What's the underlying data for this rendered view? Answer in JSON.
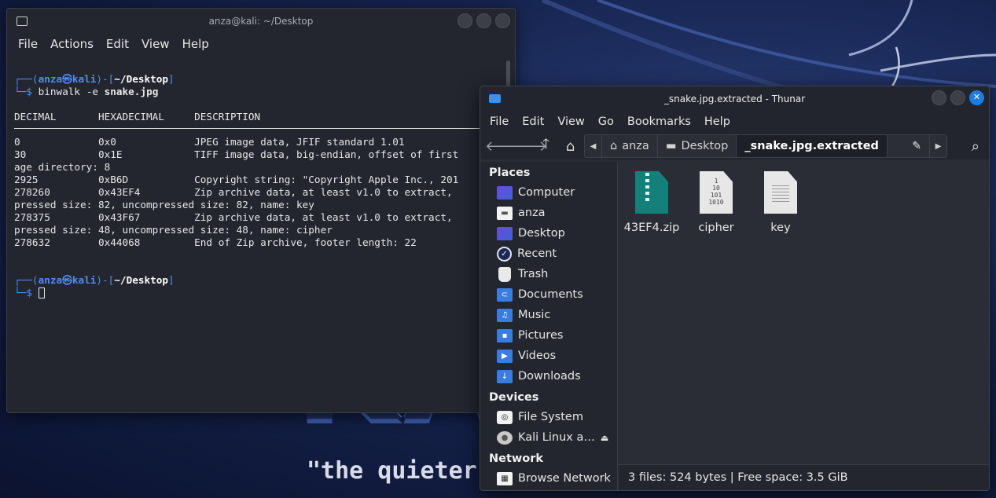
{
  "wallpaper": {
    "logo_text": "KA",
    "tagline": "\"the quieter"
  },
  "terminal": {
    "title": "anza@kali: ~/Desktop",
    "menu": [
      "File",
      "Actions",
      "Edit",
      "View",
      "Help"
    ],
    "prompt": {
      "user": "anza",
      "host": "kali",
      "path": "~/Desktop",
      "at_symbol": "㉿"
    },
    "command": "binwalk",
    "command_flag": "-e",
    "command_arg": "snake.jpg",
    "table_header": "DECIMAL       HEXADECIMAL     DESCRIPTION",
    "output_lines": [
      "0             0x0             JPEG image data, JFIF standard 1.01",
      "30            0x1E            TIFF image data, big-endian, offset of first",
      "age directory: 8",
      "2925          0xB6D           Copyright string: \"Copyright Apple Inc., 201",
      "278260        0x43EF4         Zip archive data, at least v1.0 to extract,",
      "pressed size: 82, uncompressed size: 82, name: key",
      "278375        0x43F67         Zip archive data, at least v1.0 to extract,",
      "pressed size: 48, uncompressed size: 48, name: cipher",
      "278632        0x44068         End of Zip archive, footer length: 22"
    ]
  },
  "thunar": {
    "title": "_snake.jpg.extracted - Thunar",
    "menu": [
      "File",
      "Edit",
      "View",
      "Go",
      "Bookmarks",
      "Help"
    ],
    "path": [
      "anza",
      "Desktop",
      "_snake.jpg.extracted"
    ],
    "sidebar": {
      "places_title": "Places",
      "places": [
        "Computer",
        "anza",
        "Desktop",
        "Recent",
        "Trash",
        "Documents",
        "Music",
        "Pictures",
        "Videos",
        "Downloads"
      ],
      "devices_title": "Devices",
      "devices": [
        "File System",
        "Kali Linux a…"
      ],
      "network_title": "Network",
      "network": [
        "Browse Network"
      ]
    },
    "files": [
      {
        "name": "43EF4.zip",
        "icon": "zip-archive-icon"
      },
      {
        "name": "cipher",
        "icon": "binary-file-icon"
      },
      {
        "name": "key",
        "icon": "text-file-icon"
      }
    ],
    "binary_icon_text": "1\n10\n101\n1010",
    "status": "3 files: 524 bytes  |  Free space: 3.5 GiB"
  },
  "colors": {
    "accent": "#1e7be0",
    "prompt_blue": "#4f8cf4",
    "terminal_bg": "#23262f",
    "thunar_bg": "#2a2d35"
  }
}
